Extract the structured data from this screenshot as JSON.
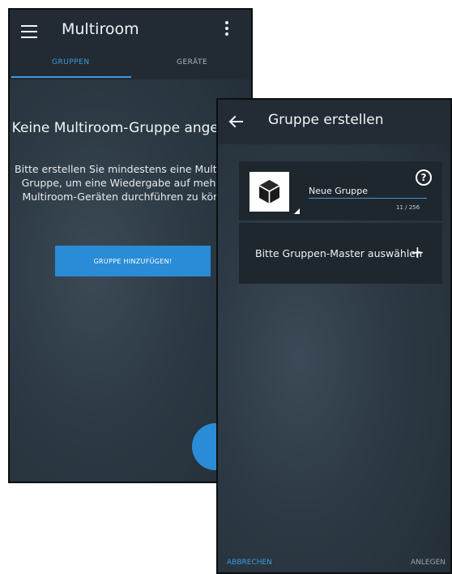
{
  "back_screen": {
    "app_title": "Multiroom",
    "tabs": [
      {
        "label": "GRUPPEN",
        "active": true
      },
      {
        "label": "GERÄTE",
        "active": false
      }
    ],
    "empty_title": "Keine Multiroom-Gruppe angelegt!",
    "empty_text": "Bitte erstellen Sie mindestens eine Multiroom-Gruppe, um eine Wiedergabe auf mehreren Multiroom-Geräten durchführen zu können.",
    "add_group_button": "GRUPPE HINZUFÜGEN!",
    "fab_label": "+"
  },
  "front_screen": {
    "title": "Gruppe erstellen",
    "group_name_value": "Neue Gruppe",
    "char_counter": "11 / 256",
    "help_icon": "?",
    "master_label": "Bitte Gruppen-Master auswählen",
    "master_add": "+",
    "cancel_label": "ABBRECHEN",
    "create_label": "ANLEGEN"
  },
  "colors": {
    "accent": "#2a8cd6",
    "background": "#2c3944",
    "appbar": "#222b33",
    "card": "#1f272e"
  },
  "icons": [
    "menu-icon",
    "more-vert-icon",
    "back-arrow-icon",
    "cube-icon",
    "help-icon",
    "plus-icon"
  ]
}
